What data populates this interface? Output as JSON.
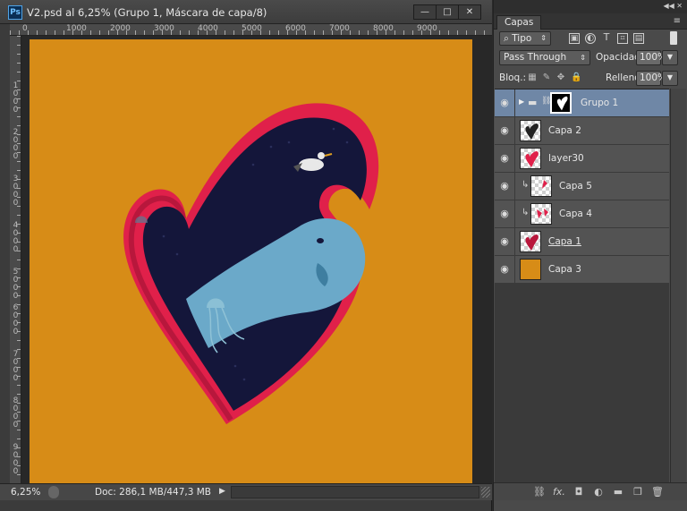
{
  "window": {
    "title": "V2.psd al 6,25% (Grupo 1, Máscara de capa/8)",
    "app_icon": "Ps",
    "buttons": {
      "minimize": "—",
      "maximize": "□",
      "close": "✕"
    }
  },
  "rulers": {
    "top": [
      "0",
      "1000",
      "2000",
      "3000",
      "4000",
      "5000",
      "6000",
      "7000",
      "8000",
      "9000"
    ],
    "left": [
      "1\n0\n0\n0",
      "2\n0\n0\n0",
      "3\n0\n0\n0",
      "4\n0\n0\n0",
      "5\n0\n0\n0",
      "6\n0\n0\n0",
      "7\n0\n0\n0",
      "8\n0\n0\n0",
      "9\n0\n0\n0"
    ]
  },
  "status": {
    "zoom": "6,25%",
    "doc_info": "Doc: 286,1 MB/447,3 MB"
  },
  "panel": {
    "tab": "Capas",
    "filter": {
      "selected": "Tipo",
      "icons": [
        "image-filter-icon",
        "adjustment-filter-icon",
        "type-filter-icon",
        "shape-filter-icon",
        "smart-object-filter-icon"
      ]
    },
    "blend_mode": "Pass Through",
    "opacity_label": "Opacidad:",
    "opacity_value": "100%",
    "lock_label": "Bloq.:",
    "fill_label": "Relleno:",
    "fill_value": "100%",
    "layers": [
      {
        "name": "Grupo 1",
        "type": "group",
        "selected": true
      },
      {
        "name": "Capa 2",
        "type": "layer"
      },
      {
        "name": "layer30",
        "type": "layer"
      },
      {
        "name": "Capa 5",
        "type": "clipped"
      },
      {
        "name": "Capa 4",
        "type": "clipped"
      },
      {
        "name": "Capa 1",
        "type": "layer",
        "underlined": true
      },
      {
        "name": "Capa 3",
        "type": "fill",
        "color": "#d78c17"
      }
    ],
    "footer_icons": [
      "link-icon",
      "fx-icon",
      "mask-icon",
      "adjustment-icon",
      "folder-icon",
      "new-layer-icon",
      "trash-icon"
    ],
    "footer_fx": "fx."
  },
  "colors": {
    "canvas_bg": "#d78c17",
    "heart_red": "#e0204a",
    "night": "#14163a",
    "whale": "#6ba9c9"
  }
}
